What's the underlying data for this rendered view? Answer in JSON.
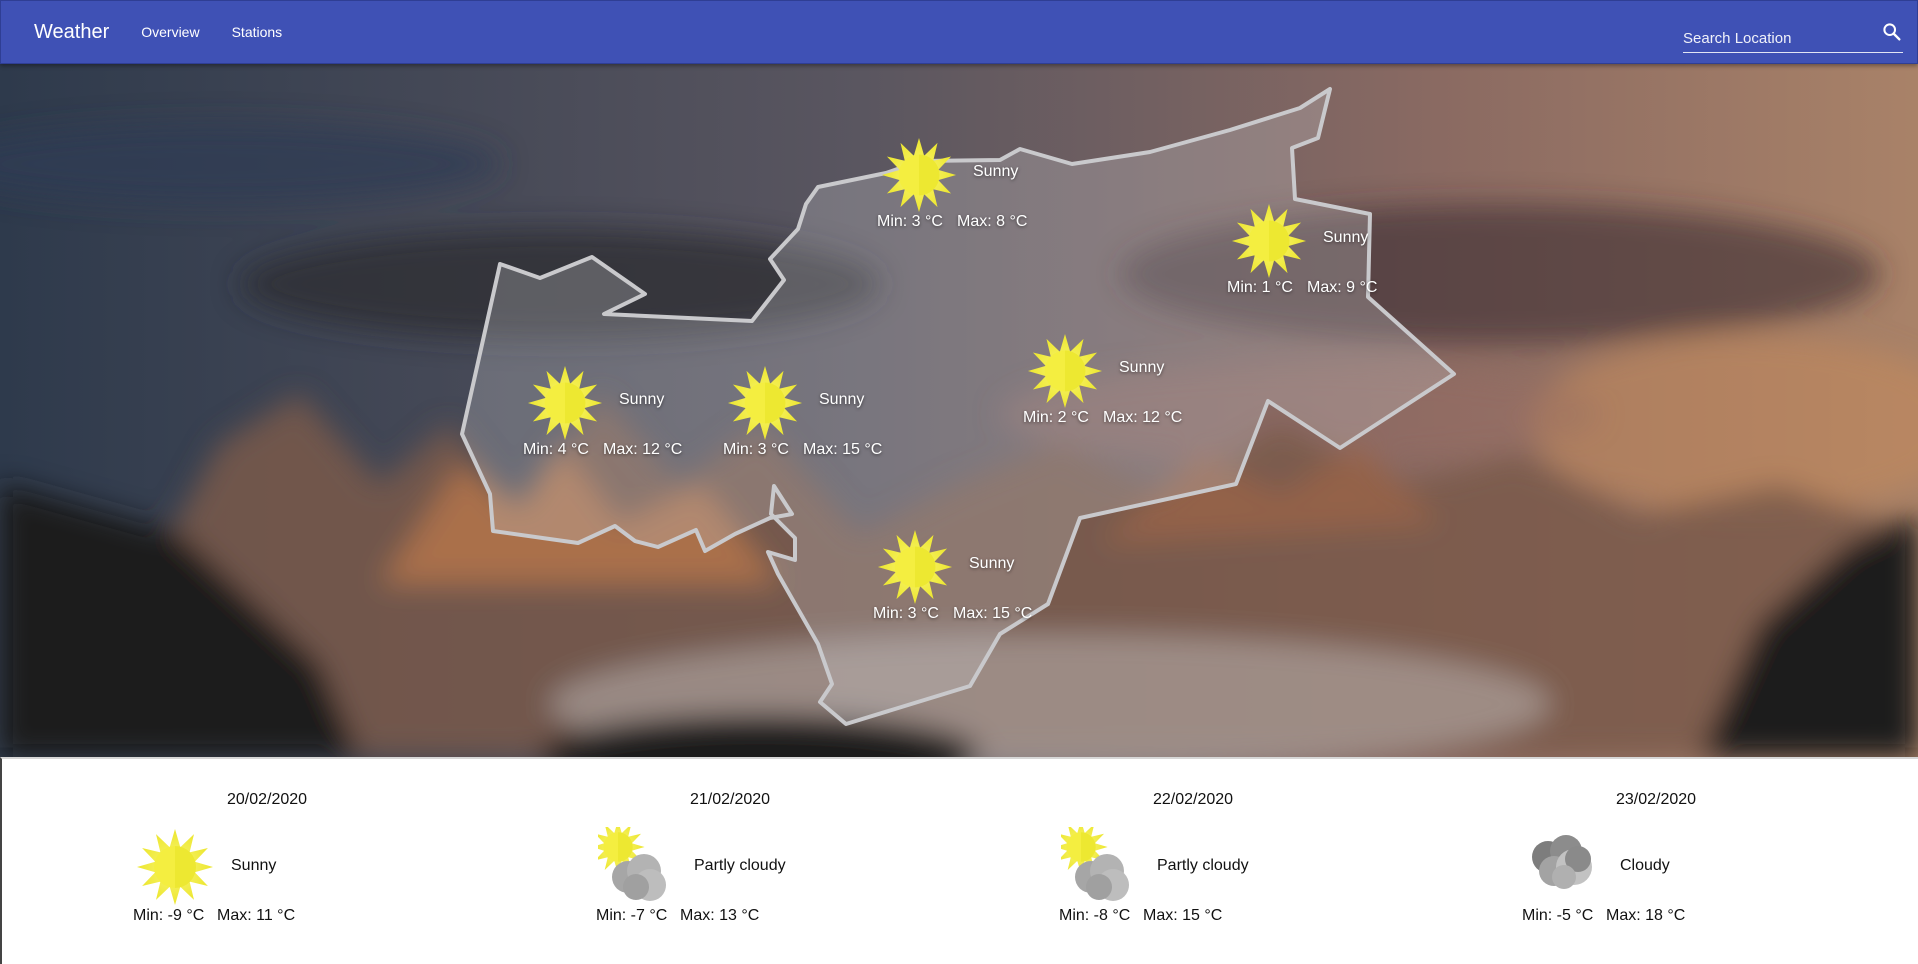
{
  "header": {
    "brand": "Weather",
    "nav": [
      "Overview",
      "Stations"
    ],
    "search_placeholder": "Search Location"
  },
  "colors": {
    "appbar": "#3f51b5",
    "sun": "#f2ec3a",
    "cloud": "#9e9e9e"
  },
  "map": {
    "stations": [
      {
        "condition": "Sunny",
        "min": "Min: 3 °C",
        "max": "Max: 8 °C",
        "icon": "sun-icon"
      },
      {
        "condition": "Sunny",
        "min": "Min: 1 °C",
        "max": "Max: 9 °C",
        "icon": "sun-icon"
      },
      {
        "condition": "Sunny",
        "min": "Min: 2 °C",
        "max": "Max: 12 °C",
        "icon": "sun-icon"
      },
      {
        "condition": "Sunny",
        "min": "Min: 4 °C",
        "max": "Max: 12 °C",
        "icon": "sun-icon"
      },
      {
        "condition": "Sunny",
        "min": "Min: 3 °C",
        "max": "Max: 15 °C",
        "icon": "sun-icon"
      },
      {
        "condition": "Sunny",
        "min": "Min: 3 °C",
        "max": "Max: 15 °C",
        "icon": "sun-icon"
      }
    ]
  },
  "forecast": [
    {
      "date": "20/02/2020",
      "condition": "Sunny",
      "icon": "sun-icon",
      "min": "Min: -9 °C",
      "max": "Max: 11 °C"
    },
    {
      "date": "21/02/2020",
      "condition": "Partly cloudy",
      "icon": "partly-cloudy-icon",
      "min": "Min: -7 °C",
      "max": "Max: 13 °C"
    },
    {
      "date": "22/02/2020",
      "condition": "Partly cloudy",
      "icon": "partly-cloudy-icon",
      "min": "Min: -8 °C",
      "max": "Max: 15 °C"
    },
    {
      "date": "23/02/2020",
      "condition": "Cloudy",
      "icon": "cloudy-icon",
      "min": "Min: -5 °C",
      "max": "Max: 18 °C"
    }
  ]
}
